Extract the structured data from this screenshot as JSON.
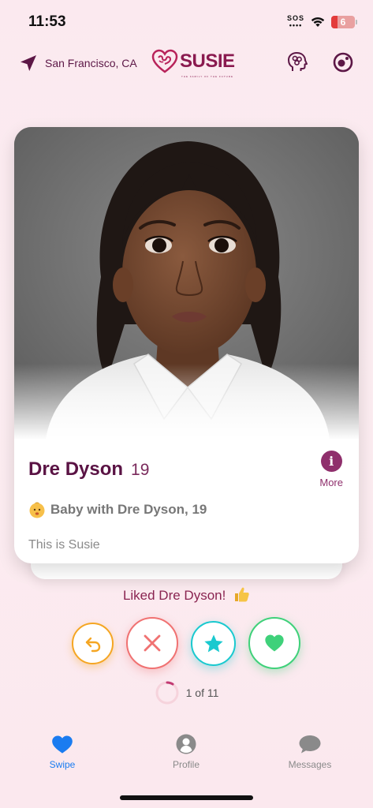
{
  "status_bar": {
    "time": "11:53",
    "sos": "SOS",
    "battery": "6"
  },
  "header": {
    "location": "San Francisco, CA",
    "logo": "SUSIE",
    "logo_tagline": "THE FAMILY OF THE FUTURE"
  },
  "card": {
    "name": "Dre Dyson",
    "age": "19",
    "more_label": "More",
    "more_icon": "i",
    "baby_line": "Baby with Dre Dyson, 19",
    "bio": "This is Susie"
  },
  "liked_message": "Liked Dre Dyson!",
  "actions": {
    "undo": "undo-icon",
    "nope": "close-icon",
    "superlike": "star-icon",
    "like": "heart-icon"
  },
  "counter": {
    "text": "1 of 11",
    "progress": 0.09
  },
  "tabs": [
    {
      "label": "Swipe",
      "icon": "heart-icon",
      "active": true
    },
    {
      "label": "Profile",
      "icon": "person-icon",
      "active": false
    },
    {
      "label": "Messages",
      "icon": "chat-icon",
      "active": false
    }
  ],
  "colors": {
    "brand": "#8a1a4f",
    "active_tab": "#1a7cf0",
    "undo": "#f5a623",
    "nope": "#f07272",
    "star": "#19c9cf",
    "like": "#3fd17a"
  }
}
